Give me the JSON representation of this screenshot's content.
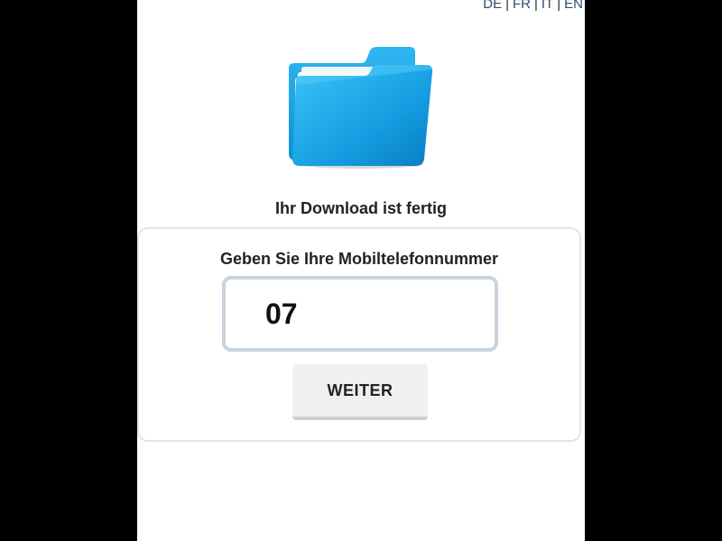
{
  "languages": [
    "DE",
    "FR",
    "IT",
    "EN"
  ],
  "headline": "Ihr Download ist fertig",
  "form": {
    "label": "Geben Sie Ihre Mobiltelefonnummer",
    "phone_value": "07",
    "submit_label": "WEITER"
  },
  "colors": {
    "background": "#000000",
    "page": "#ffffff",
    "folder_blue": "#1aa7e6",
    "link": "#2a4d6e",
    "input_border": "#c9d3df",
    "button_bg": "#f0f0f0"
  },
  "icons": {
    "folder": "folder-icon"
  }
}
